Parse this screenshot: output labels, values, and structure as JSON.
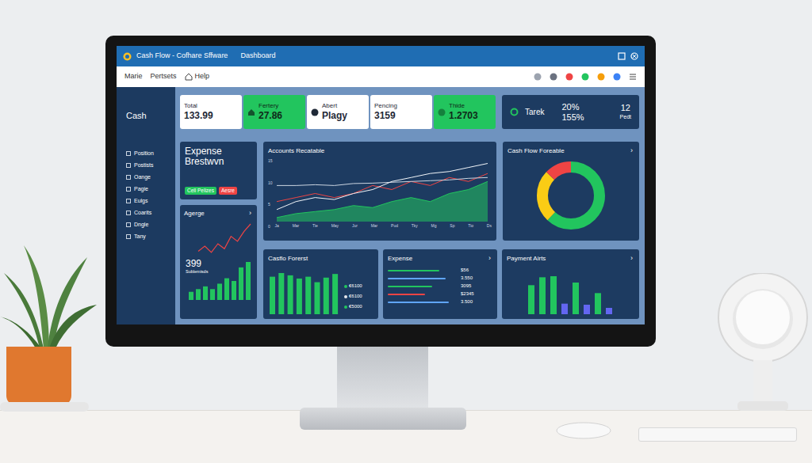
{
  "window": {
    "title": "Cash Flow - Cofhare Sffware",
    "section": "Dashboard"
  },
  "menu": [
    {
      "label": "Marie"
    },
    {
      "label": "Pertsets"
    },
    {
      "label": "Help"
    }
  ],
  "sidebar": {
    "title": "Cash",
    "items": [
      {
        "label": "Position"
      },
      {
        "label": "Postists"
      },
      {
        "label": "Oange"
      },
      {
        "label": "Pagie"
      },
      {
        "label": "Eulgs"
      },
      {
        "label": "Coarits"
      },
      {
        "label": "Dngle"
      },
      {
        "label": "Tany"
      }
    ]
  },
  "stats": [
    {
      "label": "Total",
      "value": "133.99",
      "kind": "light"
    },
    {
      "label": "Fertery",
      "value": "27.86",
      "kind": "green"
    },
    {
      "label": "Abert",
      "value": "Plagy",
      "kind": "light"
    },
    {
      "label": "Pencing",
      "value": "3159",
      "kind": "light"
    },
    {
      "label": "Thide",
      "value": "1.2703",
      "kind": "green"
    }
  ],
  "target": {
    "label": "Tarek",
    "percents": [
      "20%",
      "155%"
    ],
    "count": "12",
    "unit": "Pedt"
  },
  "expense_breakdown": {
    "title": "Expense Brestwvn",
    "buttons": [
      {
        "label": "Cell Pelizes",
        "color": "#22c55e"
      },
      {
        "label": "Aesre",
        "color": "#ef4444"
      }
    ]
  },
  "average": {
    "title": "Agerge",
    "arrow": "›",
    "value": "399",
    "caption": "Sublemisds",
    "line": [
      10,
      14,
      9,
      16,
      12,
      22,
      18,
      26,
      32
    ],
    "bars": [
      3,
      4,
      5,
      4,
      6,
      8,
      7,
      12,
      14
    ]
  },
  "receivable": {
    "title": "Accounts Recatable",
    "y_ticks": [
      "15",
      "10",
      "5",
      "0"
    ],
    "x_ticks": [
      "Ja",
      "Mar",
      "Tie",
      "May",
      "Jur",
      "Mar",
      "Pud",
      "Tky",
      "Mg",
      "Sp",
      "Tio",
      "Ds"
    ],
    "series": [
      {
        "kind": "area",
        "color": "#22c55e",
        "values": [
          1,
          2,
          2.5,
          3,
          4,
          3.5,
          5,
          6,
          5,
          7,
          8,
          10
        ]
      },
      {
        "kind": "line",
        "color": "#ef4444",
        "values": [
          5,
          6,
          7,
          6,
          7,
          9,
          8,
          10,
          9,
          11,
          10,
          12
        ]
      },
      {
        "kind": "line",
        "color": "#cbd5e1",
        "values": [
          9,
          9,
          9.2,
          9,
          9.5,
          9.6,
          9.8,
          10,
          10.2,
          10.4,
          10.8,
          11
        ]
      },
      {
        "kind": "line",
        "color": "#f1f5f9",
        "values": [
          3,
          5,
          6,
          5.5,
          7,
          8,
          10,
          11,
          12,
          12.5,
          13.5,
          14.5
        ]
      }
    ]
  },
  "donut": {
    "title": "Cash Flow Foreable",
    "arrow": "›",
    "segments": [
      {
        "value": 62,
        "color": "#22c55e"
      },
      {
        "value": 25,
        "color": "#facc15"
      },
      {
        "value": 13,
        "color": "#ef4444"
      }
    ]
  },
  "cash_forecast": {
    "title": "Casflo Forerst",
    "bars": [
      82,
      90,
      85,
      78,
      82,
      70,
      80,
      88
    ],
    "labels": [
      {
        "text": "€6100",
        "color": "#22c55e"
      },
      {
        "text": "€6100",
        "color": "#e5e7eb"
      },
      {
        "text": "€5000",
        "color": "#22c55e"
      }
    ]
  },
  "expense": {
    "title": "Expense",
    "arrow": "›",
    "rows": [
      {
        "value": "$56",
        "level": 0.75,
        "color": "#22c55e"
      },
      {
        "value": "3.550",
        "level": 0.85,
        "color": "#60a5fa"
      },
      {
        "value": "3095",
        "level": 0.65,
        "color": "#22c55e"
      },
      {
        "value": "$2345",
        "level": 0.55,
        "color": "#ef4444"
      },
      {
        "value": "3.500",
        "level": 0.9,
        "color": "#60a5fa"
      }
    ]
  },
  "payments": {
    "title": "Payment Airts",
    "arrow": "›",
    "bars": [
      {
        "value": 55,
        "color": "#22c55e"
      },
      {
        "value": 70,
        "color": "#22c55e"
      },
      {
        "value": 72,
        "color": "#22c55e"
      },
      {
        "value": 20,
        "color": "#6366f1"
      },
      {
        "value": 60,
        "color": "#22c55e"
      },
      {
        "value": 18,
        "color": "#6366f1"
      },
      {
        "value": 40,
        "color": "#22c55e"
      },
      {
        "value": 12,
        "color": "#6366f1"
      }
    ]
  }
}
